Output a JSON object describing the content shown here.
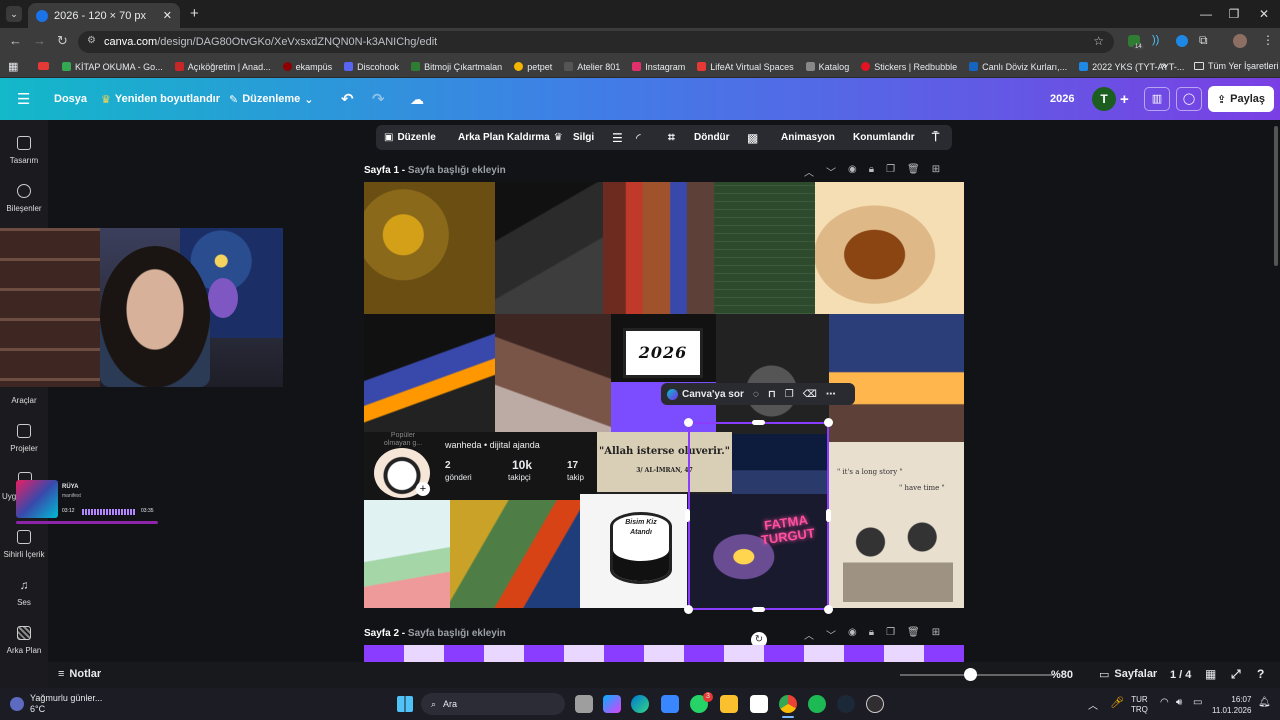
{
  "browser": {
    "tab_title": "2026 - 120 × 70 px",
    "url_host": "canva.com",
    "url_path": "/design/DAG80OtvGKo/XeVxsxdZNQN0N-k3ANIChg/edit",
    "extension_badge": "14"
  },
  "bookmarks": [
    {
      "label": "KİTAP OKUMA - Go...",
      "color": "#34a853"
    },
    {
      "label": "Açıköğretim | Anad...",
      "color": "#c62828"
    },
    {
      "label": "ekampüs",
      "color": "#8e0000"
    },
    {
      "label": "Discohook",
      "color": "#5865f2"
    },
    {
      "label": "Bitmoji Çıkartmalan",
      "color": "#2e7d32"
    },
    {
      "label": "petpet",
      "color": "#f4b400"
    },
    {
      "label": "Atelier 801",
      "color": "#555555"
    },
    {
      "label": "Instagram",
      "color": "#e1306c"
    },
    {
      "label": "LifeAt Virtual Spaces",
      "color": "#e53935"
    },
    {
      "label": "Katalog",
      "color": "#888888"
    },
    {
      "label": "Stickers | Redbubble",
      "color": "#e41321"
    },
    {
      "label": "Canlı Döviz Kurları,...",
      "color": "#1565c0"
    },
    {
      "label": "2022 YKS (TYT-AYT-...",
      "color": "#1e88e5"
    }
  ],
  "all_bookmarks_label": "Tüm Yer İşaretleri",
  "canva_header": {
    "file": "Dosya",
    "resize": "Yeniden boyutlandır",
    "edit": "Düzenleme",
    "title": "2026",
    "avatar_letter": "T",
    "share": "Paylaş"
  },
  "context_toolbar": {
    "edit": "Düzenle",
    "bg_remove": "Arka Plan Kaldırma",
    "erase": "Silgi",
    "flip": "Döndür",
    "animate": "Animasyon",
    "position": "Konumlandır"
  },
  "rail": [
    {
      "label": "Tasarım"
    },
    {
      "label": "Bileşenler"
    },
    {
      "label": "Araçlar"
    },
    {
      "label": "Projeler"
    },
    {
      "label": "Uygu"
    },
    {
      "label": "Sihirli İçerik"
    },
    {
      "label": "Ses"
    },
    {
      "label": "Arka Plan"
    }
  ],
  "music_widget": {
    "title": "RÜYA",
    "artist": "manifest",
    "elapsed": "03:12",
    "total": "03:35"
  },
  "pages": [
    {
      "label": "Sayfa 1 -",
      "placeholder": "Sayfa başlığı ekleyin"
    },
    {
      "label": "Sayfa 2 -",
      "placeholder": "Sayfa başlığı ekleyin"
    }
  ],
  "collage": {
    "badge_year": "2026",
    "ask_canva": "Canva'ya sor",
    "profile": {
      "hint": "Popüler olmayan g...",
      "name": "wanheda • dijital ajanda",
      "posts": "2",
      "posts_label": "gönderi",
      "followers": "10k",
      "followers_label": "takipçi",
      "following": "17",
      "following_label": "takip"
    },
    "quote": "\"Allah isterse olu­verir.\"",
    "quote_ref": "3/ AL-İMRAN, 47",
    "cake_text": "Bisim Kiz Atandı",
    "concert_text": "FATMA TURGUT",
    "story_text_1": "\" it's a long story \"",
    "story_text_2": "\" have time \""
  },
  "canva_bottom": {
    "notes": "Notlar",
    "zoom": "%80",
    "zoom_level": 0.8,
    "pages_label": "Sayfalar",
    "page_count": "1 / 4"
  },
  "taskbar": {
    "weather": "Yağmurlu günler...",
    "temp": "6°C",
    "search": "Ara",
    "whatsapp_badge": "3",
    "lang1": "TUR",
    "lang2": "TRQ",
    "time": "16:07",
    "date": "11.01.2026"
  }
}
